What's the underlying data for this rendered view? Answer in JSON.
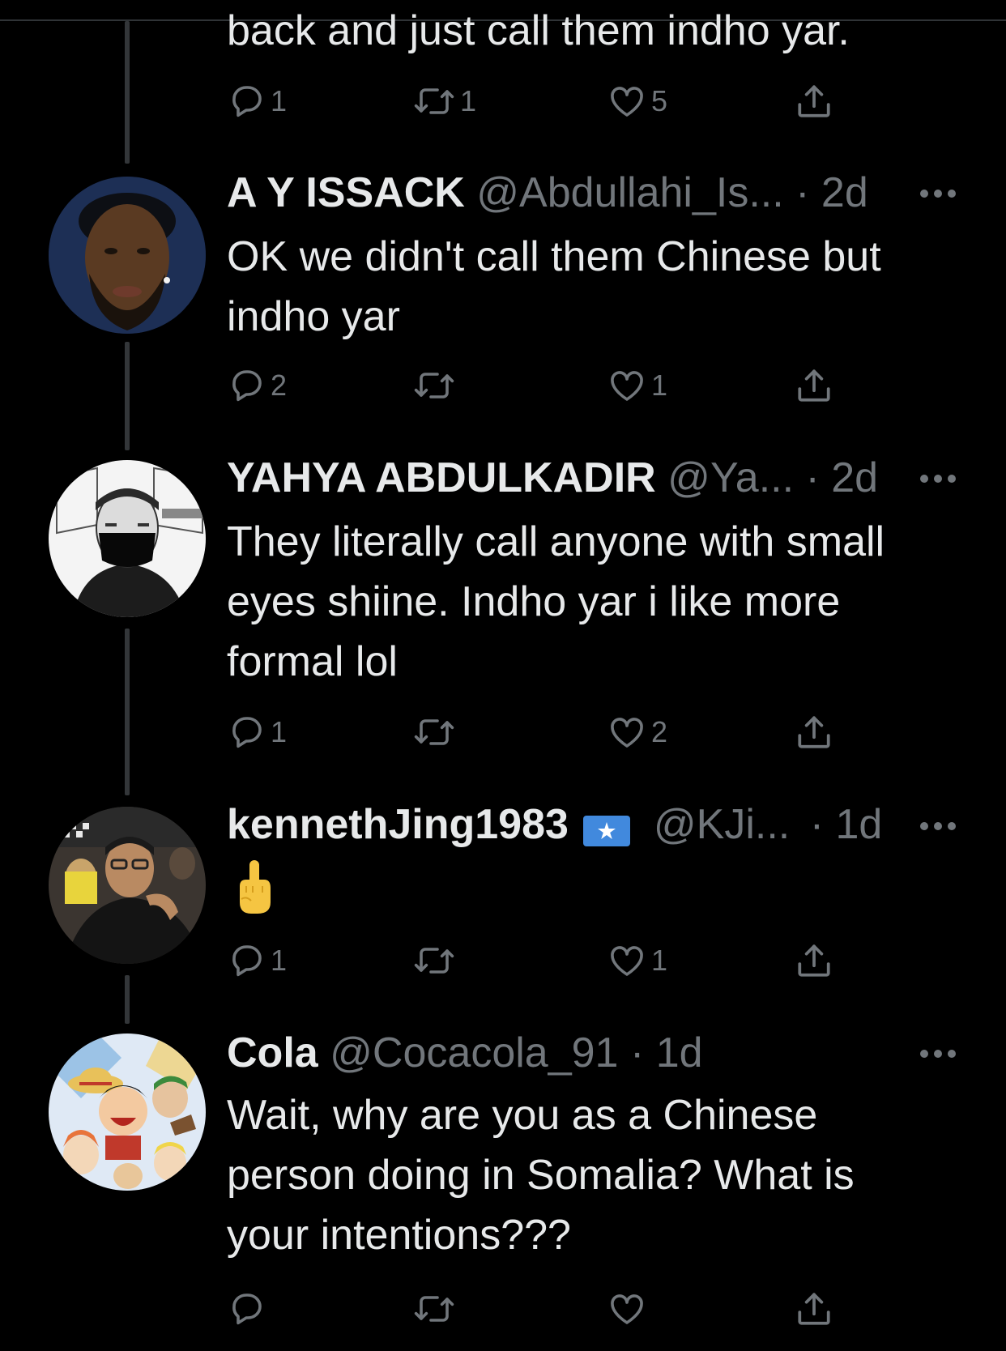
{
  "colors": {
    "background": "#000000",
    "text_primary": "#e7e9ea",
    "text_secondary": "#71767b",
    "thread_line": "#333639"
  },
  "partial_tweet": {
    "text": "back and just call them indho yar.",
    "actions": {
      "replies": "1",
      "retweets": "1",
      "likes": "5"
    }
  },
  "tweets": [
    {
      "name": "A Y ISSACK",
      "handle": "@Abdullahi_Is...",
      "dot": "·",
      "time": "2d",
      "text_lines": [
        "OK we didn't call them Chinese but",
        "indho yar"
      ],
      "actions": {
        "replies": "2",
        "retweets": "",
        "likes": "1"
      }
    },
    {
      "name": "YAHYA ABDULKADIR",
      "handle": "@Ya...",
      "dot": "·",
      "time": "2d",
      "text_lines": [
        "They literally call anyone with small",
        "eyes shiine. Indho yar i like more",
        "formal lol"
      ],
      "actions": {
        "replies": "1",
        "retweets": "",
        "likes": "2"
      }
    },
    {
      "name": "kennethJing1983",
      "flag": "somalia-flag-icon",
      "handle": "@KJi...",
      "dot": "·",
      "time": "1d",
      "text": "middle-finger-emoji",
      "actions": {
        "replies": "1",
        "retweets": "",
        "likes": "1"
      }
    },
    {
      "name": "Cola",
      "handle": "@Cocacola_91",
      "dot": "·",
      "time": "1d",
      "text_lines": [
        "Wait, why are you as a Chinese",
        "person doing in Somalia? What is",
        "your intentions???"
      ],
      "actions": {
        "replies": "",
        "retweets": "",
        "likes": ""
      }
    }
  ],
  "icons": [
    "reply-icon",
    "retweet-icon",
    "like-icon",
    "share-icon",
    "more-icon"
  ]
}
